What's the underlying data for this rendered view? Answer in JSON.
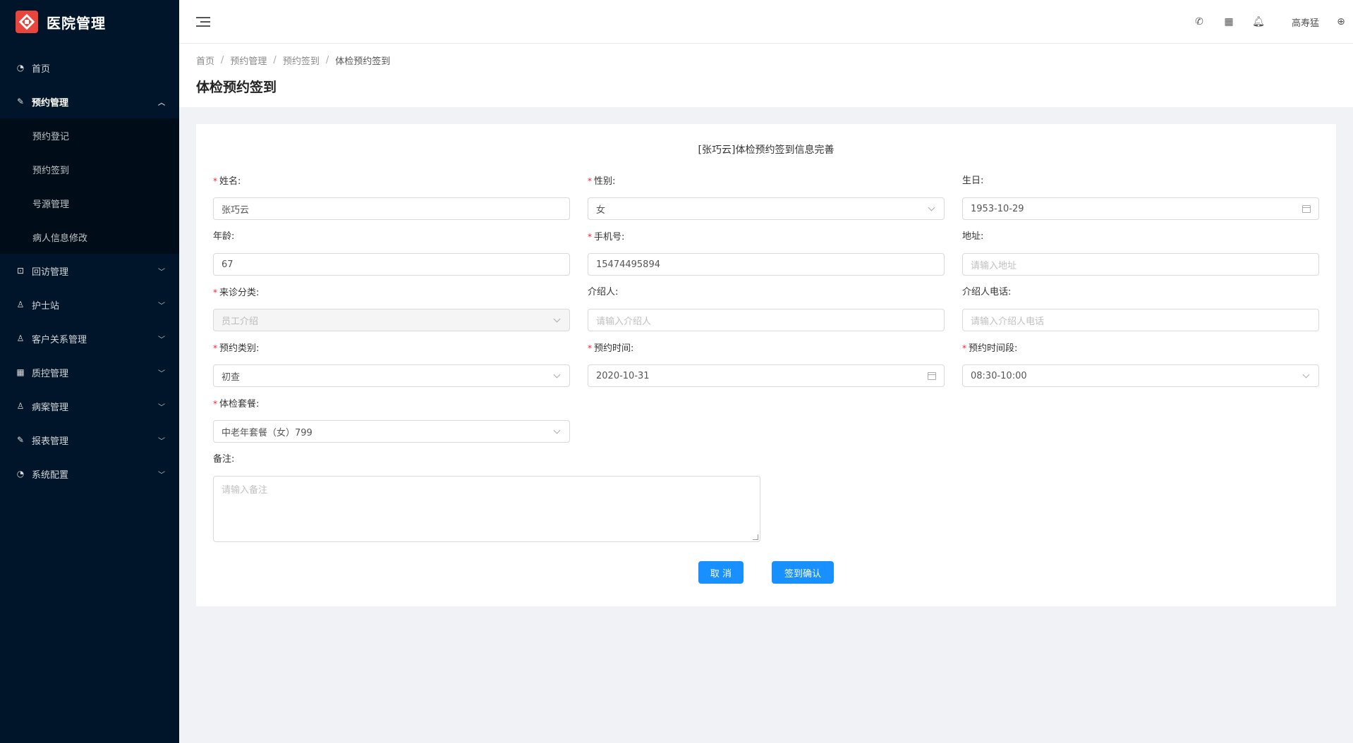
{
  "app": {
    "title": "医院管理"
  },
  "sidebar": {
    "items": [
      {
        "label": "首页",
        "icon": "dashboard-icon"
      },
      {
        "label": "预约管理",
        "icon": "edit-icon",
        "open": true
      },
      {
        "label": "回访管理",
        "icon": "lock-icon"
      },
      {
        "label": "护士站",
        "icon": "user-icon"
      },
      {
        "label": "客户关系管理",
        "icon": "user-icon"
      },
      {
        "label": "质控管理",
        "icon": "table-icon"
      },
      {
        "label": "病案管理",
        "icon": "user-icon"
      },
      {
        "label": "报表管理",
        "icon": "edit-icon"
      },
      {
        "label": "系统配置",
        "icon": "dashboard-icon"
      }
    ],
    "submenu": [
      "预约登记",
      "预约签到",
      "号源管理",
      "病人信息修改"
    ]
  },
  "header": {
    "user": "高寿猛"
  },
  "breadcrumb": [
    "首页",
    "预约管理",
    "预约签到",
    "体检预约签到"
  ],
  "page_title": "体检预约签到",
  "form": {
    "title": "[张巧云]体检预约签到信息完善",
    "name": {
      "label": "姓名:",
      "value": "张巧云"
    },
    "gender": {
      "label": "性别:",
      "value": "女"
    },
    "birthday": {
      "label": "生日:",
      "value": "1953-10-29"
    },
    "age": {
      "label": "年龄:",
      "value": "67"
    },
    "phone": {
      "label": "手机号:",
      "value": "15474495894"
    },
    "address": {
      "label": "地址:",
      "placeholder": "请输入地址"
    },
    "visit_type": {
      "label": "来诊分类:",
      "value": "员工介绍"
    },
    "referrer": {
      "label": "介绍人:",
      "placeholder": "请输入介绍人"
    },
    "referrer_phone": {
      "label": "介绍人电话:",
      "placeholder": "请输入介绍人电话"
    },
    "appt_category": {
      "label": "预约类别:",
      "value": "初查"
    },
    "appt_time": {
      "label": "预约时间:",
      "value": "2020-10-31"
    },
    "appt_period": {
      "label": "预约时间段:",
      "value": "08:30-10:00"
    },
    "package": {
      "label": "体检套餐:",
      "value": "中老年套餐（女）799"
    },
    "remark": {
      "label": "备注:",
      "placeholder": "请输入备注"
    },
    "cancel_label": "取 消",
    "confirm_label": "签到确认"
  },
  "colors": {
    "sidebar_bg": "#001529",
    "primary": "#1890ff",
    "required": "#f5222d"
  }
}
